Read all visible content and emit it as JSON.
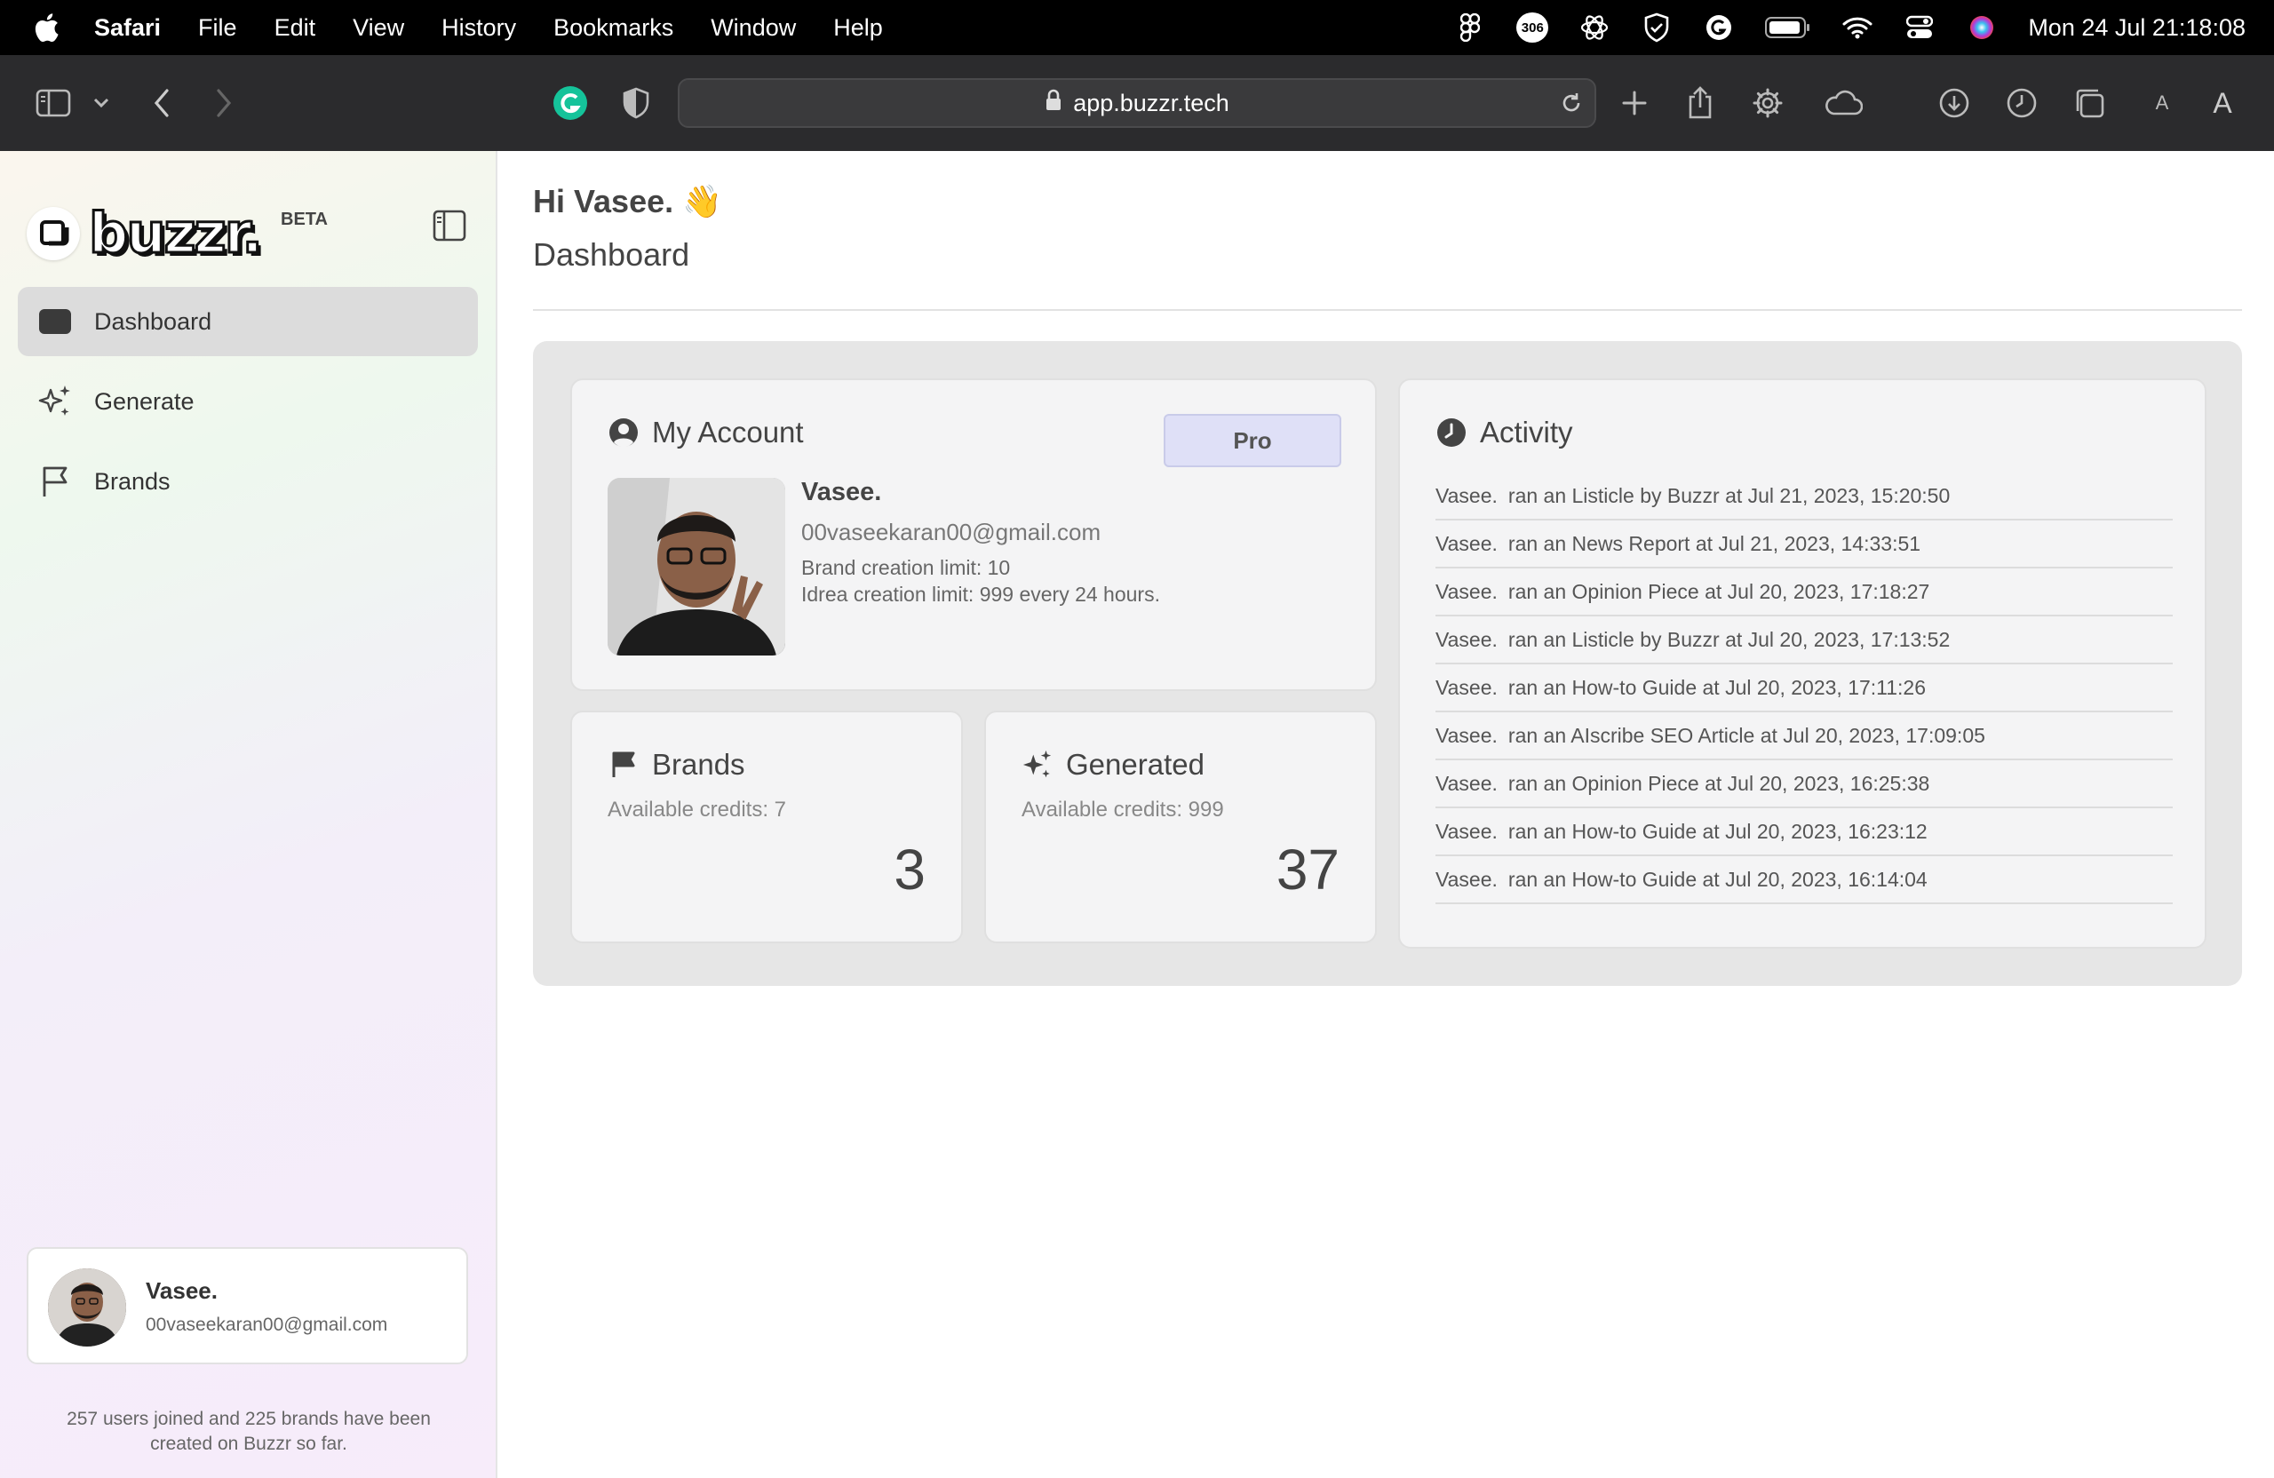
{
  "menubar": {
    "app": "Safari",
    "items": [
      "File",
      "Edit",
      "View",
      "History",
      "Bookmarks",
      "Window",
      "Help"
    ],
    "badge_count": "306",
    "clock": "Mon 24 Jul  21:18:08"
  },
  "browser": {
    "url": "app.buzzr.tech",
    "text_size_small": "A",
    "text_size_large": "A"
  },
  "sidebar": {
    "logo_text": "buzzr.",
    "beta_label": "BETA",
    "nav": [
      {
        "label": "Dashboard",
        "icon": "folder-icon"
      },
      {
        "label": "Generate",
        "icon": "sparkles-icon"
      },
      {
        "label": "Brands",
        "icon": "flag-icon"
      }
    ],
    "user": {
      "name": "Vasee.",
      "email": "00vaseekaran00@gmail.com"
    },
    "footer": "257 users joined and 225 brands have been created on Buzzr so far."
  },
  "main": {
    "greeting": "Hi Vasee. 👋",
    "title": "Dashboard",
    "account": {
      "title": "My Account",
      "plan": "Pro",
      "name": "Vasee.",
      "email": "00vaseekaran00@gmail.com",
      "brand_limit": "Brand creation limit: 10",
      "idea_limit": "Idrea creation limit: 999 every 24 hours."
    },
    "brands": {
      "title": "Brands",
      "credits": "Available credits: 7",
      "count": "3"
    },
    "generated": {
      "title": "Generated",
      "credits": "Available credits: 999",
      "count": "37"
    },
    "activity": {
      "title": "Activity",
      "rows": [
        {
          "who": "Vasee.",
          "text": "ran an Listicle by Buzzr at Jul 21, 2023, 15:20:50"
        },
        {
          "who": "Vasee.",
          "text": "ran an News Report at Jul 21, 2023, 14:33:51"
        },
        {
          "who": "Vasee.",
          "text": "ran an Opinion Piece at Jul 20, 2023, 17:18:27"
        },
        {
          "who": "Vasee.",
          "text": "ran an Listicle by Buzzr at Jul 20, 2023, 17:13:52"
        },
        {
          "who": "Vasee.",
          "text": "ran an How-to Guide at Jul 20, 2023, 17:11:26"
        },
        {
          "who": "Vasee.",
          "text": "ran an AIscribe SEO Article at Jul 20, 2023, 17:09:05"
        },
        {
          "who": "Vasee.",
          "text": "ran an Opinion Piece at Jul 20, 2023, 16:25:38"
        },
        {
          "who": "Vasee.",
          "text": "ran an How-to Guide at Jul 20, 2023, 16:23:12"
        },
        {
          "who": "Vasee.",
          "text": "ran an How-to Guide at Jul 20, 2023, 16:14:04"
        }
      ]
    }
  }
}
